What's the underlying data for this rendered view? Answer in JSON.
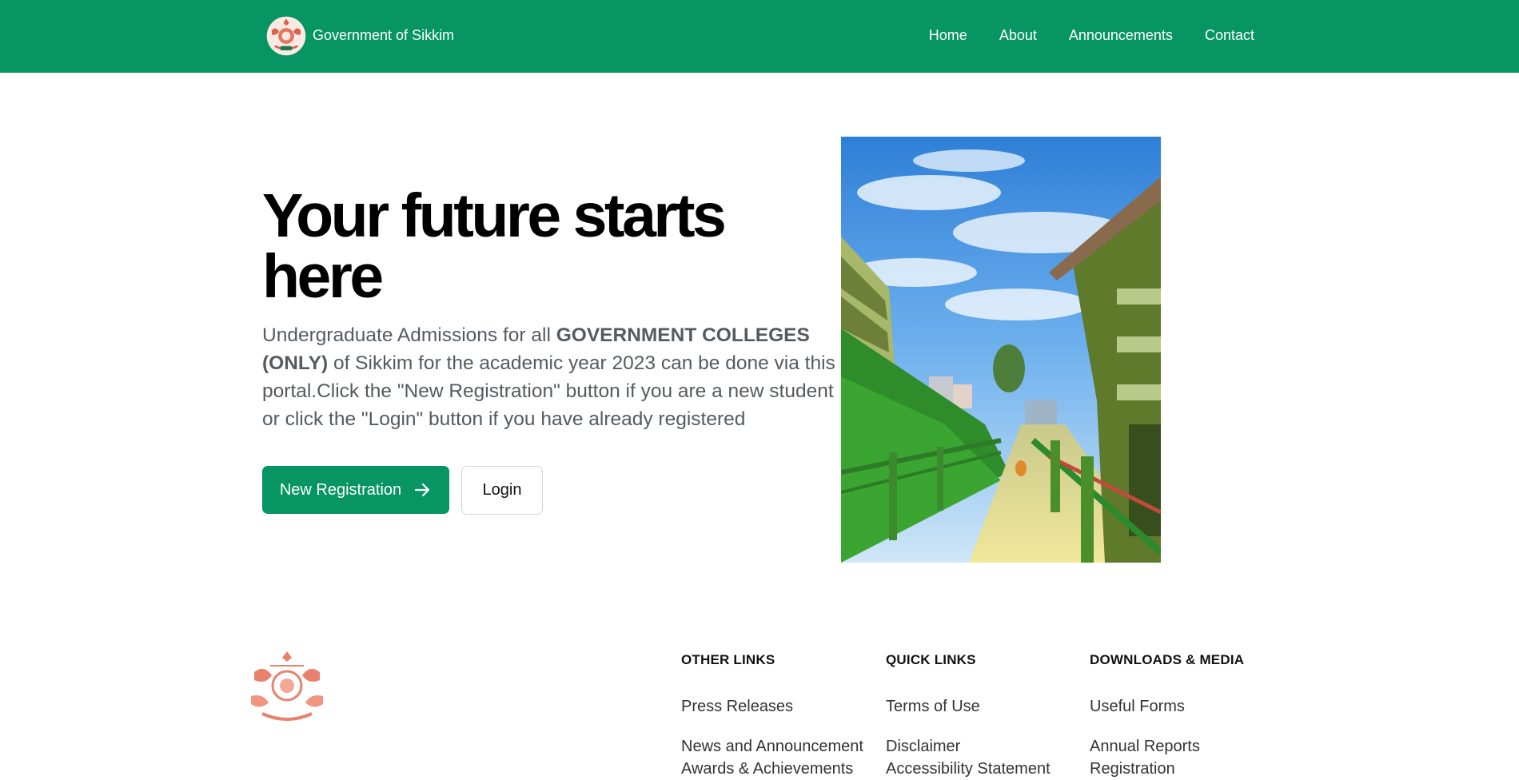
{
  "header": {
    "brand_text": "Government of Sikkim",
    "background": "#069563",
    "nav": [
      {
        "label": "Home"
      },
      {
        "label": "About"
      },
      {
        "label": "Announcements"
      },
      {
        "label": "Contact"
      }
    ]
  },
  "hero": {
    "title": "Your future starts here",
    "text_before": "Undergraduate Admissions for all ",
    "text_bold": "GOVERNMENT COLLEGES (ONLY)",
    "text_after": " of Sikkim for the academic year 2023 can be done via this portal.Click the \"New Registration\" button if you are a new student or click the \"Login\" button if you have already registered",
    "primary_button": "New Registration",
    "secondary_button": "Login",
    "accent": "#069563"
  },
  "footer": {
    "columns": [
      {
        "heading": "OTHER LINKS",
        "items": [
          "Press Releases",
          "News and Announcement",
          "Awards & Achievements"
        ]
      },
      {
        "heading": "QUICK LINKS",
        "items": [
          "Terms of Use",
          "Disclaimer",
          "Accessibility Statement"
        ]
      },
      {
        "heading": "DOWNLOADS & MEDIA",
        "items": [
          "Useful Forms",
          "Annual Reports",
          "Registration"
        ]
      }
    ]
  }
}
